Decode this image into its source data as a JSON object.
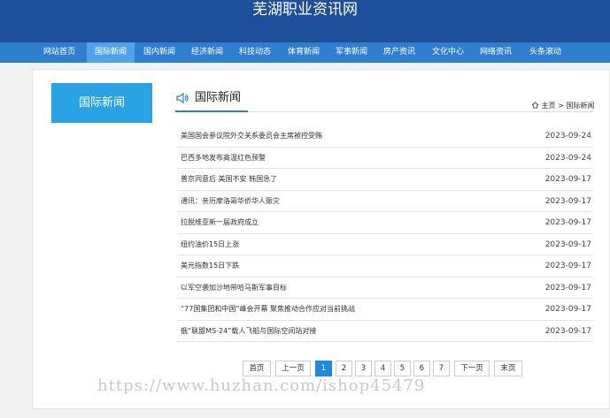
{
  "site": {
    "title": "芜湖职业资讯网"
  },
  "nav": [
    {
      "label": "网站首页",
      "active": false
    },
    {
      "label": "国际新闻",
      "active": true
    },
    {
      "label": "国内新闻",
      "active": false
    },
    {
      "label": "经济新闻",
      "active": false
    },
    {
      "label": "科技动态",
      "active": false
    },
    {
      "label": "体育新闻",
      "active": false
    },
    {
      "label": "军事新闻",
      "active": false
    },
    {
      "label": "房产资讯",
      "active": false
    },
    {
      "label": "文化中心",
      "active": false
    },
    {
      "label": "网络资讯",
      "active": false
    },
    {
      "label": "头条滚动",
      "active": false
    }
  ],
  "sidebar": {
    "title": "国际新闻"
  },
  "section": {
    "title": "国际新闻"
  },
  "breadcrumb": {
    "home": "主页",
    "sep": ">",
    "current": "国际新闻"
  },
  "articles": [
    {
      "title": "美国国会参议院外交关系委员会主席被控受贿",
      "date": "2023-09-24"
    },
    {
      "title": "巴西多地发布高温红色预警",
      "date": "2023-09-24"
    },
    {
      "title": "普京同意后 美国不安 韩国急了",
      "date": "2023-09-17"
    },
    {
      "title": "通讯：亲历摩洛哥华侨华人赈灾",
      "date": "2023-09-17"
    },
    {
      "title": "拉脱维亚新一届政府成立",
      "date": "2023-09-17"
    },
    {
      "title": "纽约油价15日上涨",
      "date": "2023-09-17"
    },
    {
      "title": "美元指数15日下跌",
      "date": "2023-09-17"
    },
    {
      "title": "以军空袭加沙地带哈马斯军事目标",
      "date": "2023-09-17"
    },
    {
      "title": "“77国集团和中国”峰会开幕 聚焦推动合作应对当前挑战",
      "date": "2023-09-17"
    },
    {
      "title": "俄“联盟MS-24”载人飞船与国际空间站对接",
      "date": "2023-09-17"
    }
  ],
  "pagination": {
    "first": "首页",
    "prev": "上一页",
    "pages": [
      "1",
      "2",
      "3",
      "4",
      "5",
      "6",
      "7"
    ],
    "current": "1",
    "next": "下一页",
    "last": "末页"
  },
  "watermark": "https://www.huzhan.com/ishop45479",
  "colors": {
    "header": "#1d4f9a",
    "nav": "#2f7fd0",
    "accent": "#2aa3e4"
  }
}
